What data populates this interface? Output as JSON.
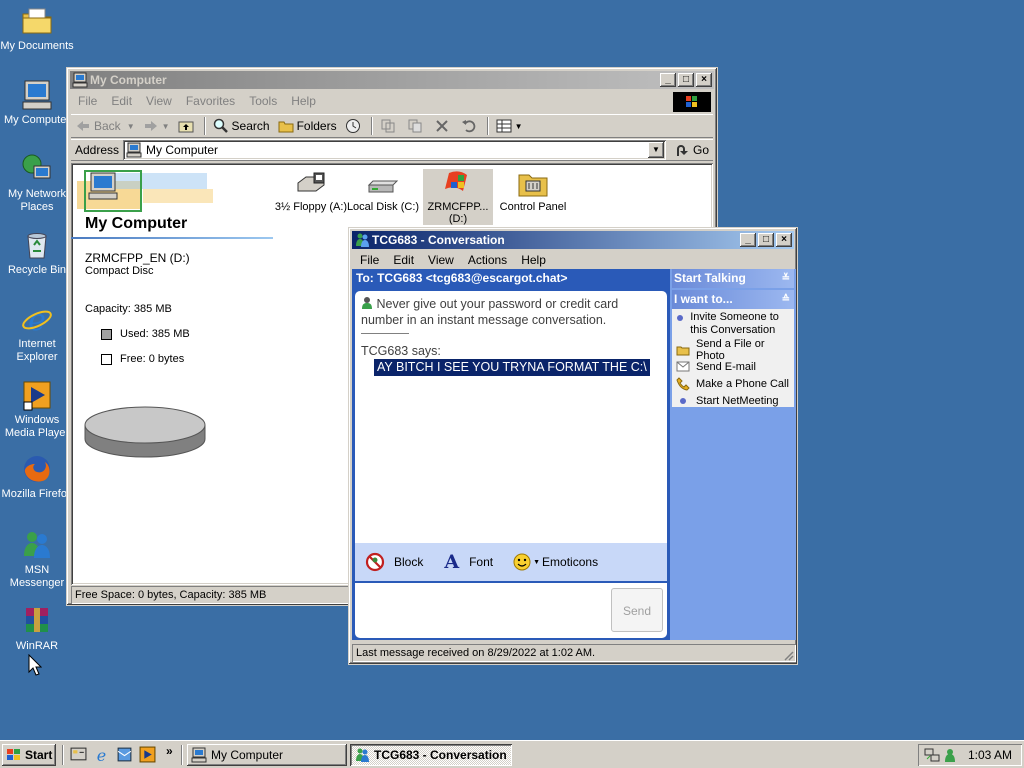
{
  "desktop": {
    "icons": [
      {
        "label": "My Documents",
        "icon": "folder-documents-icon"
      },
      {
        "label": "My Computer",
        "icon": "computer-icon"
      },
      {
        "label": "My Network Places",
        "icon": "network-places-icon"
      },
      {
        "label": "Recycle Bin",
        "icon": "recycle-bin-icon"
      },
      {
        "label": "Internet Explorer",
        "icon": "internet-explorer-icon"
      },
      {
        "label": "Windows Media Player",
        "icon": "media-player-icon"
      },
      {
        "label": "Mozilla Firefox",
        "icon": "firefox-icon"
      },
      {
        "label": "MSN Messenger",
        "icon": "msn-messenger-icon"
      },
      {
        "label": "WinRAR",
        "icon": "winrar-icon"
      }
    ]
  },
  "explorer": {
    "title": "My Computer",
    "menu": [
      "File",
      "Edit",
      "View",
      "Favorites",
      "Tools",
      "Help"
    ],
    "toolbar": {
      "back": "Back",
      "search": "Search",
      "folders": "Folders"
    },
    "address_label": "Address",
    "address_value": "My Computer",
    "go_label": "Go",
    "panel_title": "My Computer",
    "selected_name": "ZRMCFPP_EN (D:)",
    "selected_type": "Compact Disc",
    "capacity": "Capacity: 385 MB",
    "used": "Used: 385 MB",
    "free": "Free: 0 bytes",
    "used_fraction": 1.0,
    "drives": [
      {
        "label": "3½ Floppy (A:)",
        "icon": "floppy-drive-icon"
      },
      {
        "label": "Local Disk (C:)",
        "icon": "hard-disk-icon"
      },
      {
        "label": "ZRMCFPP... (D:)",
        "icon": "cd-drive-icon"
      },
      {
        "label": "Control Panel",
        "icon": "control-panel-icon"
      }
    ],
    "status": "Free Space: 0 bytes, Capacity: 385 MB"
  },
  "conversation": {
    "title": "TCG683 - Conversation",
    "menu": [
      "File",
      "Edit",
      "View",
      "Actions",
      "Help"
    ],
    "to": "To:  TCG683 <tcg683@escargot.chat>",
    "warning": "Never give out your password or credit card number in an instant message conversation.",
    "sender": "TCG683 says:",
    "message": "AY BITCH I SEE YOU TRYNA FORMAT THE C:\\",
    "block_label": "Block",
    "font_label": "Font",
    "emoticons_label": "Emoticons",
    "send_label": "Send",
    "status": "Last message received on 8/29/2022 at 1:02 AM.",
    "sidebar": {
      "start_talking": "Start Talking",
      "i_want_to": "I want to...",
      "actions": [
        {
          "label": "Invite Someone to this Conversation",
          "icon": "invite-bullet-icon"
        },
        {
          "label": "Send a File or Photo",
          "icon": "send-file-icon"
        },
        {
          "label": "Send E-mail",
          "icon": "email-icon"
        },
        {
          "label": "Make a Phone Call",
          "icon": "phone-icon"
        },
        {
          "label": "Start NetMeeting",
          "icon": "netmeeting-bullet-icon"
        }
      ]
    }
  },
  "taskbar": {
    "start_label": "Start",
    "tasks": [
      {
        "label": "My Computer",
        "active": false
      },
      {
        "label": "TCG683 - Conversation",
        "active": true
      }
    ],
    "clock": "1:03 AM"
  }
}
